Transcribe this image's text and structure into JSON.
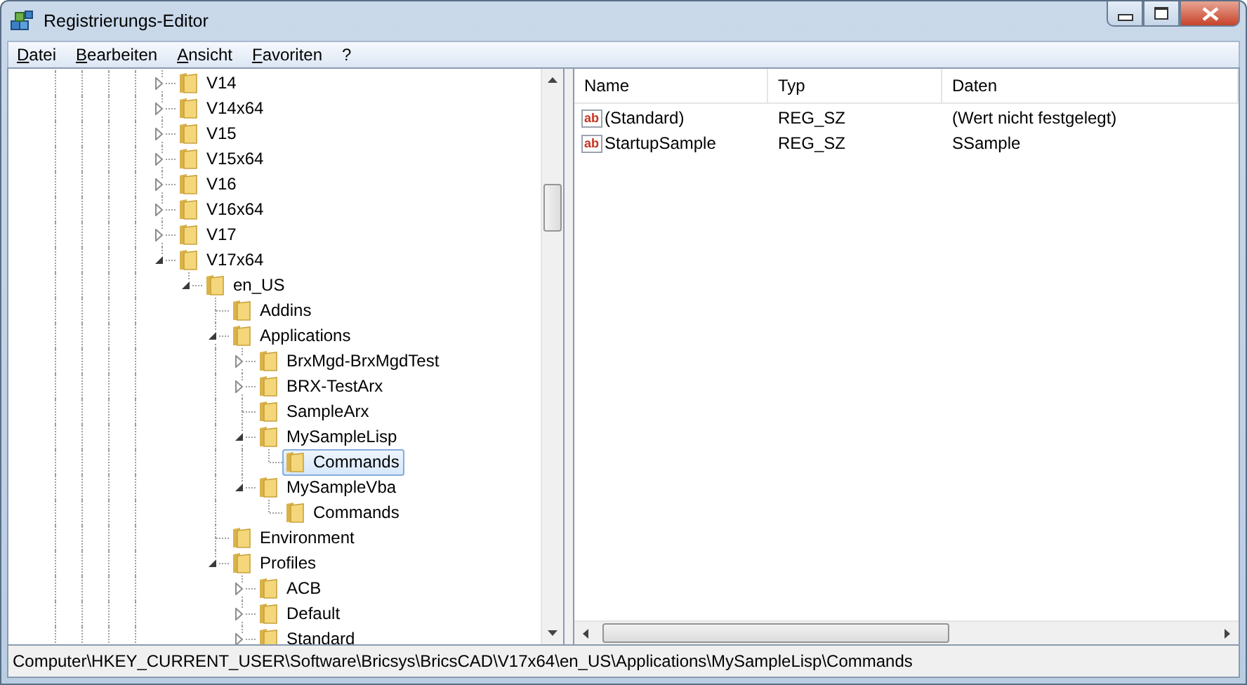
{
  "window": {
    "title": "Registrierungs-Editor"
  },
  "menu": [
    {
      "label": "Datei"
    },
    {
      "label": "Bearbeiten"
    },
    {
      "label": "Ansicht"
    },
    {
      "label": "Favoriten"
    },
    {
      "label": "?"
    }
  ],
  "tree": [
    {
      "label": "V14",
      "expandable": true,
      "expanded": false,
      "selected": false
    },
    {
      "label": "V14x64",
      "expandable": true,
      "expanded": false,
      "selected": false
    },
    {
      "label": "V15",
      "expandable": true,
      "expanded": false,
      "selected": false
    },
    {
      "label": "V15x64",
      "expandable": true,
      "expanded": false,
      "selected": false
    },
    {
      "label": "V16",
      "expandable": true,
      "expanded": false,
      "selected": false
    },
    {
      "label": "V16x64",
      "expandable": true,
      "expanded": false,
      "selected": false
    },
    {
      "label": "V17",
      "expandable": true,
      "expanded": false,
      "selected": false
    },
    {
      "label": "V17x64",
      "expandable": true,
      "expanded": true,
      "selected": false,
      "children": [
        {
          "label": "en_US",
          "expandable": true,
          "expanded": true,
          "selected": false,
          "children": [
            {
              "label": "Addins",
              "expandable": false,
              "selected": false
            },
            {
              "label": "Applications",
              "expandable": true,
              "expanded": true,
              "selected": false,
              "children": [
                {
                  "label": "BrxMgd-BrxMgdTest",
                  "expandable": true,
                  "expanded": false,
                  "selected": false
                },
                {
                  "label": "BRX-TestArx",
                  "expandable": true,
                  "expanded": false,
                  "selected": false
                },
                {
                  "label": "SampleArx",
                  "expandable": false,
                  "selected": false
                },
                {
                  "label": "MySampleLisp",
                  "expandable": true,
                  "expanded": true,
                  "selected": false,
                  "children": [
                    {
                      "label": "Commands",
                      "expandable": false,
                      "selected": true
                    }
                  ]
                },
                {
                  "label": "MySampleVba",
                  "expandable": true,
                  "expanded": true,
                  "selected": false,
                  "children": [
                    {
                      "label": "Commands",
                      "expandable": false,
                      "selected": false
                    }
                  ]
                }
              ]
            },
            {
              "label": "Environment",
              "expandable": false,
              "selected": false
            },
            {
              "label": "Profiles",
              "expandable": true,
              "expanded": true,
              "selected": false,
              "children": [
                {
                  "label": "ACB",
                  "expandable": true,
                  "expanded": false,
                  "selected": false
                },
                {
                  "label": "Default",
                  "expandable": true,
                  "expanded": false,
                  "selected": false
                },
                {
                  "label": "Standard",
                  "expandable": true,
                  "expanded": false,
                  "selected": false
                }
              ]
            }
          ]
        }
      ]
    }
  ],
  "values": {
    "columns": [
      "Name",
      "Typ",
      "Daten"
    ],
    "rows": [
      {
        "type_icon": "ab",
        "name": "(Standard)",
        "type": "REG_SZ",
        "data": "(Wert nicht festgelegt)"
      },
      {
        "type_icon": "ab",
        "name": "StartupSample",
        "type": "REG_SZ",
        "data": "SSample"
      }
    ]
  },
  "status_bar": "Computer\\HKEY_CURRENT_USER\\Software\\Bricsys\\BricsCAD\\V17x64\\en_US\\Applications\\MySampleLisp\\Commands"
}
